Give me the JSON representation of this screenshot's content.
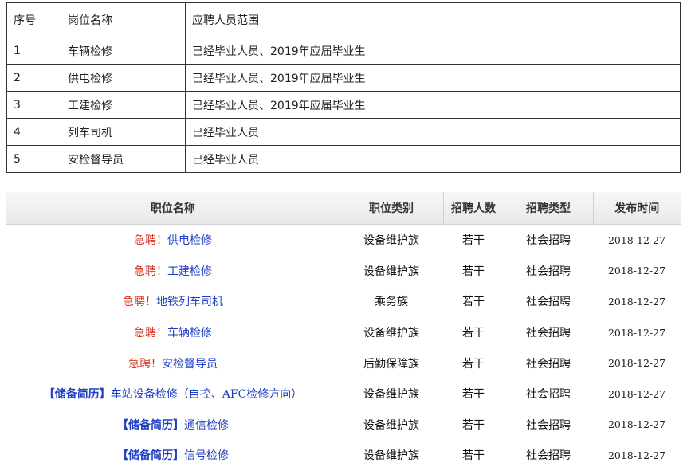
{
  "table1": {
    "headers": [
      "序号",
      "岗位名称",
      "应聘人员范围"
    ],
    "rows": [
      {
        "no": "1",
        "name": "车辆检修",
        "scope": "已经毕业人员、2019年应届毕业生"
      },
      {
        "no": "2",
        "name": "供电检修",
        "scope": "已经毕业人员、2019年应届毕业生"
      },
      {
        "no": "3",
        "name": "工建检修",
        "scope": "已经毕业人员、2019年应届毕业生"
      },
      {
        "no": "4",
        "name": "列车司机",
        "scope": "已经毕业人员"
      },
      {
        "no": "5",
        "name": "安检督导员",
        "scope": "已经毕业人员"
      }
    ]
  },
  "table2": {
    "headers": [
      "职位名称",
      "职位类别",
      "招聘人数",
      "招聘类型",
      "发布时间"
    ],
    "rows": [
      {
        "prefix": "急聘！",
        "title": "供电检修",
        "category": "设备维护族",
        "count": "若干",
        "type": "社会招聘",
        "date": "2018-12-27"
      },
      {
        "prefix": "急聘！",
        "title": "工建检修",
        "category": "设备维护族",
        "count": "若干",
        "type": "社会招聘",
        "date": "2018-12-27"
      },
      {
        "prefix": "急聘！",
        "title": "地铁列车司机",
        "category": "乘务族",
        "count": "若干",
        "type": "社会招聘",
        "date": "2018-12-27"
      },
      {
        "prefix": "急聘！",
        "title": "车辆检修",
        "category": "设备维护族",
        "count": "若干",
        "type": "社会招聘",
        "date": "2018-12-27"
      },
      {
        "prefix": "急聘！",
        "title": "安检督导员",
        "category": "后勤保障族",
        "count": "若干",
        "type": "社会招聘",
        "date": "2018-12-27"
      },
      {
        "prefix": "【储备简历】",
        "title": "车站设备检修（自控、AFC检修方向）",
        "category": "设备维护族",
        "count": "若干",
        "type": "社会招聘",
        "date": "2018-12-27"
      },
      {
        "prefix": "【储备简历】",
        "title": "通信检修",
        "category": "设备维护族",
        "count": "若干",
        "type": "社会招聘",
        "date": "2018-12-27"
      },
      {
        "prefix": "【储备简历】",
        "title": "信号检修",
        "category": "设备维护族",
        "count": "若干",
        "type": "社会招聘",
        "date": "2018-12-27"
      }
    ]
  },
  "colors": {
    "urgent": "#d9321f",
    "link": "#1f3fc4",
    "header_bg": "#ececec",
    "border": "#333333"
  }
}
